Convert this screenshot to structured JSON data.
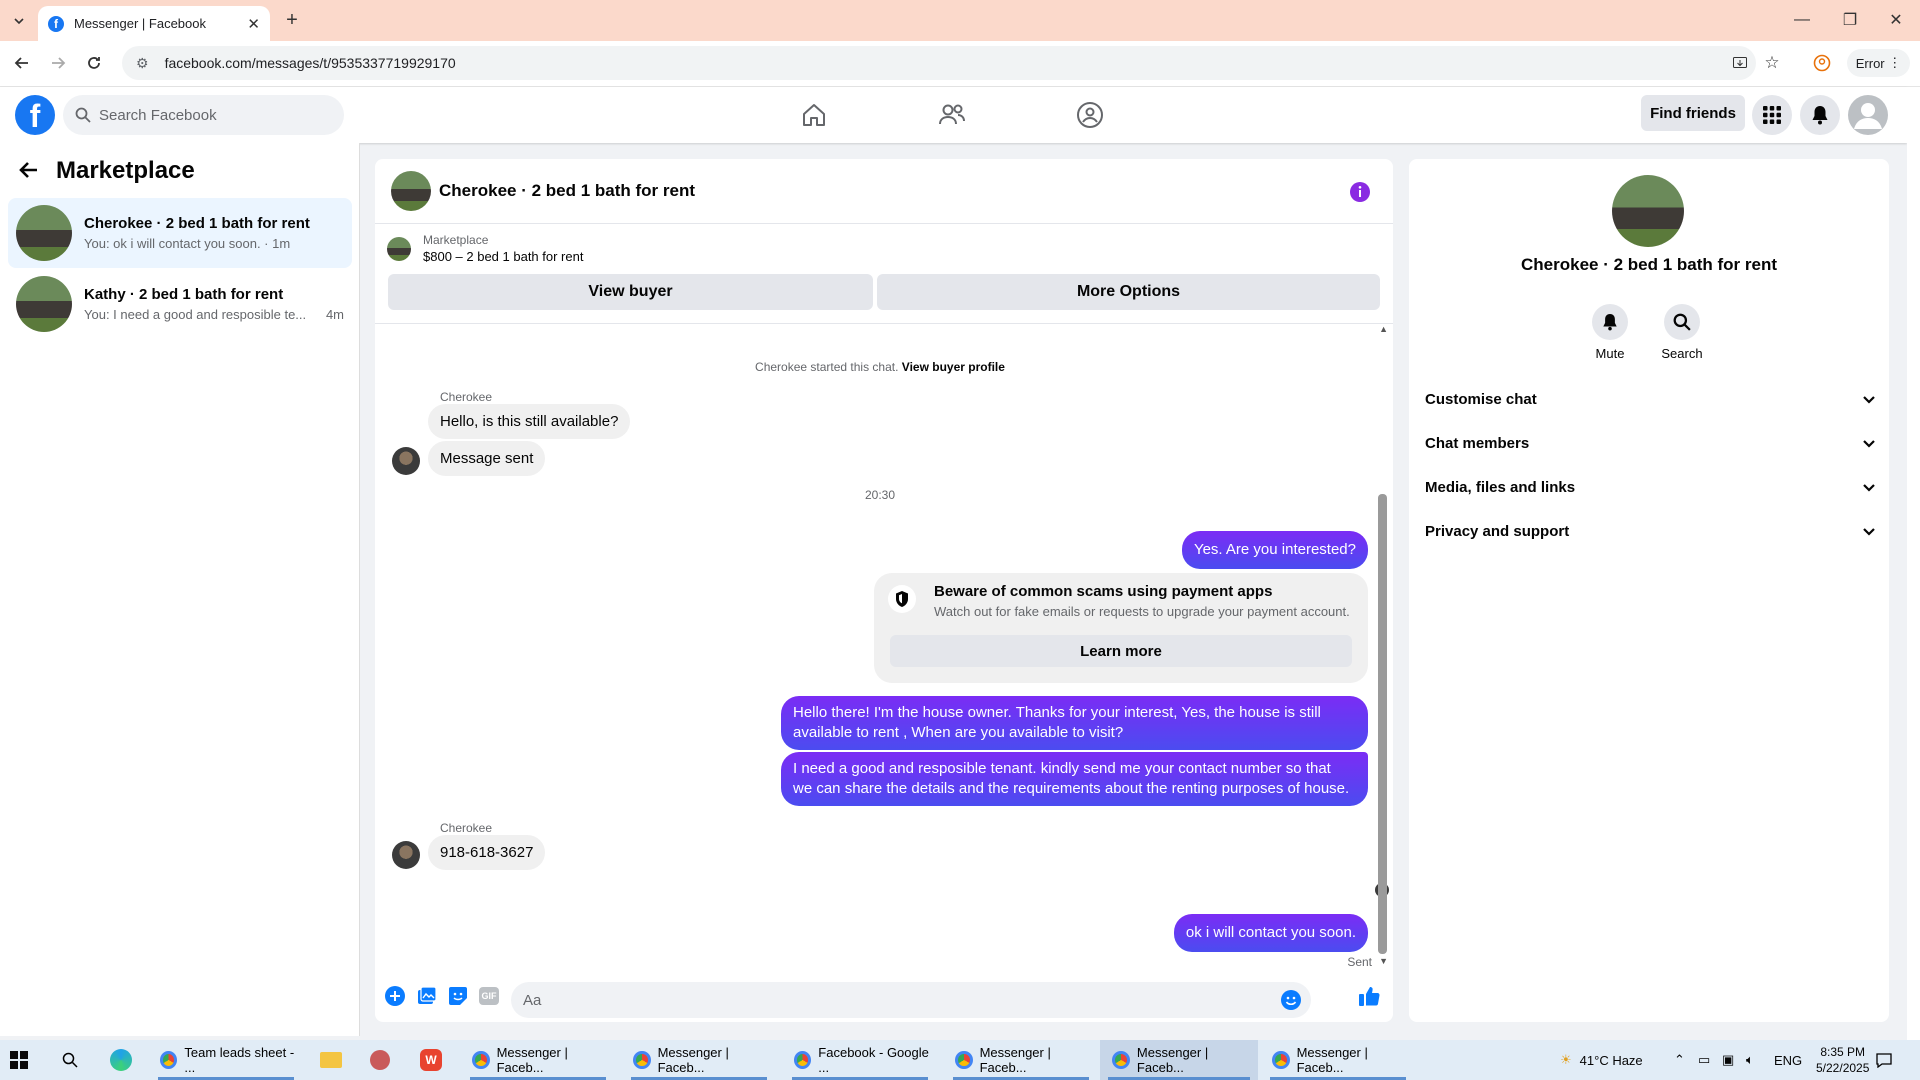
{
  "browser": {
    "tab_title": "Messenger | Facebook",
    "url": "facebook.com/messages/t/9535337719929170",
    "profile_label": "Error",
    "new_tab": "+"
  },
  "header": {
    "search_placeholder": "Search Facebook",
    "find_friends": "Find friends"
  },
  "left": {
    "title": "Marketplace",
    "conversations": [
      {
        "name": "Cherokee · 2 bed 1 bath for rent",
        "snippet": "You: ok i will contact you soon. · 1m",
        "time": ""
      },
      {
        "name": "Kathy · 2 bed 1 bath for rent",
        "snippet": "You: I need a good and resposible te...",
        "time": "4m"
      }
    ]
  },
  "chat": {
    "title": "Cherokee · 2 bed 1 bath for rent",
    "marketplace_label": "Marketplace",
    "listing_price": "$800 – 2 bed 1 bath for rent",
    "view_buyer": "View buyer",
    "more_options": "More Options",
    "started": "Cherokee started this chat.",
    "view_profile": "View buyer profile",
    "sender_name": "Cherokee",
    "in_1": "Hello, is this still available?",
    "in_2": "Message sent",
    "time_divider": "20:30",
    "out_1": "Yes. Are you interested?",
    "scam_title": "Beware of common scams using payment apps",
    "scam_body": "Watch out for fake emails or requests to upgrade your payment account.",
    "learn_more": "Learn more",
    "out_2a": "Hello there! I'm the house owner. Thanks for your interest, Yes, the house is still",
    "out_2b": "available to rent , When are you available to visit?",
    "out_3a": "I need a good and resposible tenant.  kindly send me your contact number so that",
    "out_3b": "we can share the details and the requirements about the renting purposes of house.",
    "in_3": "918-618-3627",
    "out_4": "ok i will contact you soon.",
    "sent_status": "Sent",
    "composer_placeholder": "Aa",
    "gif_label": "GIF"
  },
  "right": {
    "title": "Cherokee · 2 bed 1 bath for rent",
    "mute": "Mute",
    "search": "Search",
    "sections": [
      "Customise chat",
      "Chat members",
      "Media, files and links",
      "Privacy and support"
    ]
  },
  "taskbar": {
    "items": [
      "Team leads sheet - ...",
      "Messenger | Faceb...",
      "Messenger | Faceb...",
      "Facebook - Google ...",
      "Messenger | Faceb...",
      "Messenger | Faceb...",
      "Messenger | Faceb..."
    ],
    "weather": "41°C  Haze",
    "lang": "ENG",
    "time": "8:35 PM",
    "date": "5/22/2025"
  },
  "colors": {
    "accent": "#1877f2",
    "bubble_out": "#6236ff",
    "tab_strip": "#fbd9cb"
  }
}
